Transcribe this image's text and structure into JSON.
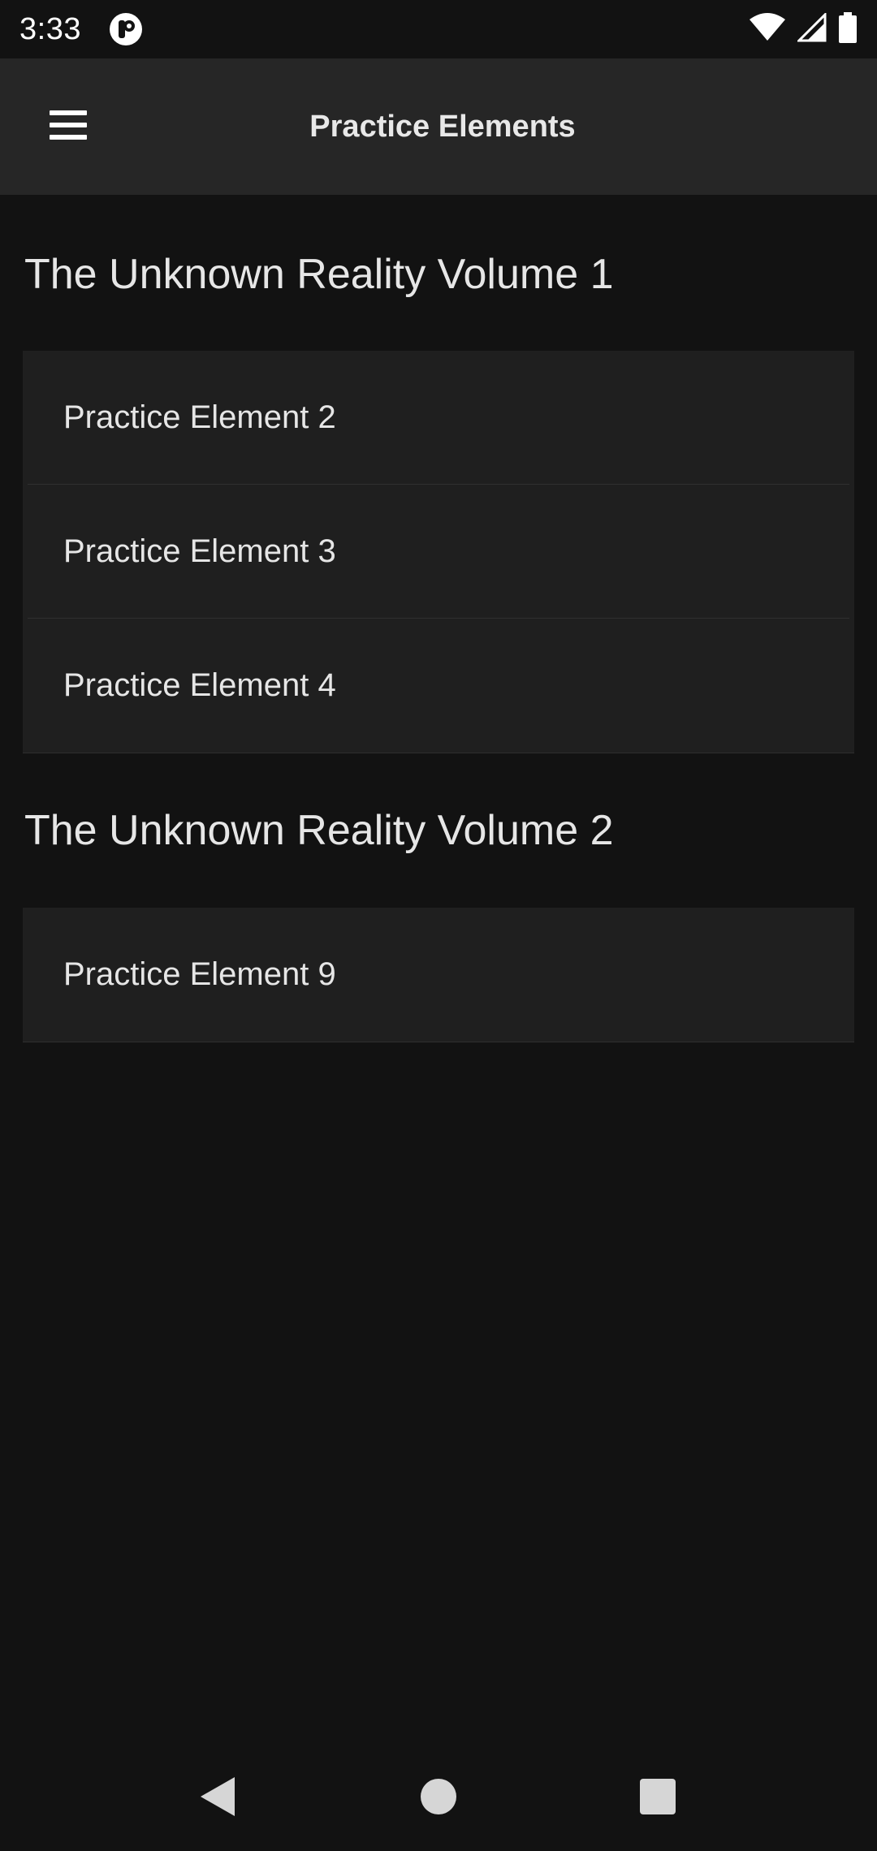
{
  "status_bar": {
    "time": "3:33",
    "icons": [
      "app-notification-icon",
      "wifi-icon",
      "signal-icon",
      "battery-icon"
    ]
  },
  "app_bar": {
    "title": "Practice Elements",
    "menu_icon": "hamburger-menu-icon"
  },
  "sections": [
    {
      "title": "The Unknown Reality Volume 1",
      "items": [
        "Practice Element 2",
        "Practice Element 3",
        "Practice Element 4"
      ]
    },
    {
      "title": "The Unknown Reality Volume 2",
      "items": [
        "Practice Element 9"
      ]
    }
  ],
  "nav_bar": {
    "icons": [
      "back-icon",
      "home-icon",
      "recents-icon"
    ]
  },
  "colors": {
    "background": "#121212",
    "app_bar": "#262626",
    "card": "#1f1f1f",
    "text": "#e6e6e6"
  }
}
